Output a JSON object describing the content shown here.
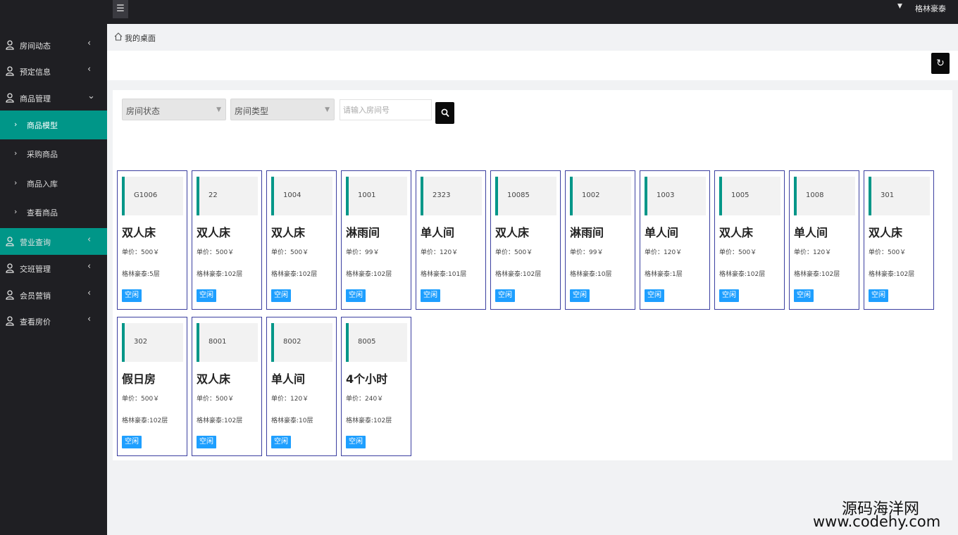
{
  "header": {
    "menu_icon": "hamburger-icon",
    "user_name": "格林豪泰",
    "user_caret": "▼"
  },
  "sidebar": {
    "items": [
      {
        "label": "房间动态",
        "arrow": "‹",
        "icon": "user-icon"
      },
      {
        "label": "预定信息",
        "arrow": "‹",
        "icon": "user-icon"
      },
      {
        "label": "商品管理",
        "arrow": "⌄",
        "icon": "user-icon"
      },
      {
        "label": "营业查询",
        "arrow": "‹",
        "icon": "user-icon"
      },
      {
        "label": "交班管理",
        "arrow": "‹",
        "icon": "user-icon"
      },
      {
        "label": "会员营销",
        "arrow": "‹",
        "icon": "user-icon"
      },
      {
        "label": "查看房价",
        "arrow": "‹",
        "icon": "user-icon"
      }
    ],
    "sub_items": [
      {
        "label": "商品模型",
        "arrow": "›"
      },
      {
        "label": "采购商品",
        "arrow": "›"
      },
      {
        "label": "商品入库",
        "arrow": "›"
      },
      {
        "label": "查看商品",
        "arrow": "›"
      }
    ]
  },
  "breadcrumb": {
    "icon": "home-icon",
    "label": "我的桌面"
  },
  "toolbar": {
    "refresh_icon": "refresh-icon",
    "refresh_glyph": "↻"
  },
  "filters": {
    "status_select": "房间状态",
    "type_select": "房间类型",
    "caret": "▼",
    "room_input_placeholder": "请输入房间号",
    "search_icon": "search-icon"
  },
  "rooms": [
    {
      "number": "G1006",
      "type": "双人床",
      "price": "单价：500￥",
      "location": "格林豪泰:5层",
      "status": "空闲"
    },
    {
      "number": "22",
      "type": "双人床",
      "price": "单价：500￥",
      "location": "格林豪泰:102层",
      "status": "空闲"
    },
    {
      "number": "1004",
      "type": "双人床",
      "price": "单价：500￥",
      "location": "格林豪泰:102层",
      "status": "空闲"
    },
    {
      "number": "1001",
      "type": "淋雨间",
      "price": "单价：99￥",
      "location": "格林豪泰:102层",
      "status": "空闲"
    },
    {
      "number": "2323",
      "type": "单人间",
      "price": "单价：120￥",
      "location": "格林豪泰:101层",
      "status": "空闲"
    },
    {
      "number": "10085",
      "type": "双人床",
      "price": "单价：500￥",
      "location": "格林豪泰:102层",
      "status": "空闲"
    },
    {
      "number": "1002",
      "type": "淋雨间",
      "price": "单价：99￥",
      "location": "格林豪泰:10层",
      "status": "空闲"
    },
    {
      "number": "1003",
      "type": "单人间",
      "price": "单价：120￥",
      "location": "格林豪泰:1层",
      "status": "空闲"
    },
    {
      "number": "1005",
      "type": "双人床",
      "price": "单价：500￥",
      "location": "格林豪泰:102层",
      "status": "空闲"
    },
    {
      "number": "1008",
      "type": "单人间",
      "price": "单价：120￥",
      "location": "格林豪泰:102层",
      "status": "空闲"
    },
    {
      "number": "301",
      "type": "双人床",
      "price": "单价：500￥",
      "location": "格林豪泰:102层",
      "status": "空闲"
    },
    {
      "number": "302",
      "type": "假日房",
      "price": "单价：500￥",
      "location": "格林豪泰:102层",
      "status": "空闲"
    },
    {
      "number": "8001",
      "type": "双人床",
      "price": "单价：500￥",
      "location": "格林豪泰:102层",
      "status": "空闲"
    },
    {
      "number": "8002",
      "type": "单人间",
      "price": "单价：120￥",
      "location": "格林豪泰:10层",
      "status": "空闲"
    },
    {
      "number": "8005",
      "type": "4个小时",
      "price": "单价：240￥",
      "location": "格林豪泰:102层",
      "status": "空闲"
    }
  ],
  "watermark": {
    "line1": "源码海洋网",
    "line2": "www.codehy.com"
  },
  "colors": {
    "sidebar_bg": "#1f1f23",
    "accent": "#009688",
    "status_badge": "#1e9fff",
    "card_border": "#3b3fa0"
  }
}
